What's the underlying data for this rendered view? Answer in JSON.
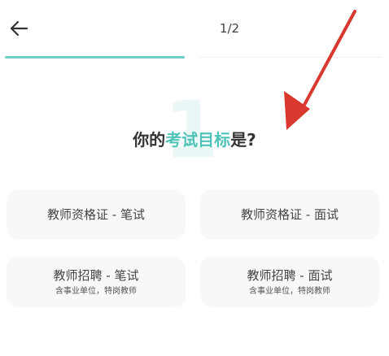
{
  "header": {
    "back_icon": "arrow-left-icon",
    "page_indicator": "1/2",
    "progress": 0.5,
    "accent_color": "#6dcfc7"
  },
  "question": {
    "step_number": "1",
    "prefix": "你的",
    "highlight": "考试目标",
    "suffix": "是?",
    "highlight_color": "#4fc3b7"
  },
  "options": [
    {
      "title": "教师资格证 - 笔试",
      "subtitle": ""
    },
    {
      "title": "教师资格证 - 面试",
      "subtitle": ""
    },
    {
      "title": "教师招聘 - 笔试",
      "subtitle": "含事业单位，特岗教师"
    },
    {
      "title": "教师招聘 - 面试",
      "subtitle": "含事业单位，特岗教师"
    }
  ],
  "annotation": {
    "arrow_color": "#d9382f"
  }
}
